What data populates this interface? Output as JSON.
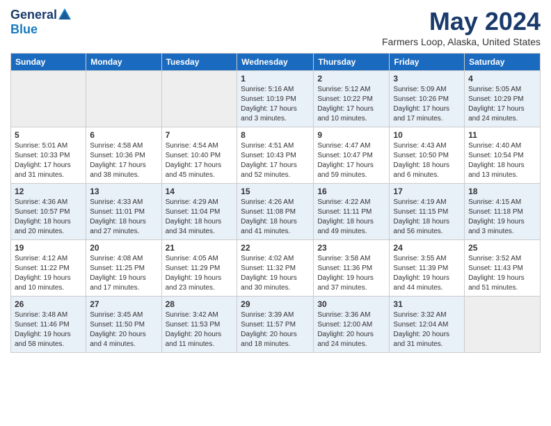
{
  "header": {
    "logo": {
      "general": "General",
      "blue": "Blue"
    },
    "title": "May 2024",
    "location": "Farmers Loop, Alaska, United States"
  },
  "weekdays": [
    "Sunday",
    "Monday",
    "Tuesday",
    "Wednesday",
    "Thursday",
    "Friday",
    "Saturday"
  ],
  "weeks": [
    [
      {
        "day": "",
        "sunrise": "",
        "sunset": "",
        "daylight": "",
        "empty": true
      },
      {
        "day": "",
        "sunrise": "",
        "sunset": "",
        "daylight": "",
        "empty": true
      },
      {
        "day": "",
        "sunrise": "",
        "sunset": "",
        "daylight": "",
        "empty": true
      },
      {
        "day": "1",
        "sunrise": "Sunrise: 5:16 AM",
        "sunset": "Sunset: 10:19 PM",
        "daylight": "Daylight: 17 hours and 3 minutes.",
        "empty": false
      },
      {
        "day": "2",
        "sunrise": "Sunrise: 5:12 AM",
        "sunset": "Sunset: 10:22 PM",
        "daylight": "Daylight: 17 hours and 10 minutes.",
        "empty": false
      },
      {
        "day": "3",
        "sunrise": "Sunrise: 5:09 AM",
        "sunset": "Sunset: 10:26 PM",
        "daylight": "Daylight: 17 hours and 17 minutes.",
        "empty": false
      },
      {
        "day": "4",
        "sunrise": "Sunrise: 5:05 AM",
        "sunset": "Sunset: 10:29 PM",
        "daylight": "Daylight: 17 hours and 24 minutes.",
        "empty": false
      }
    ],
    [
      {
        "day": "5",
        "sunrise": "Sunrise: 5:01 AM",
        "sunset": "Sunset: 10:33 PM",
        "daylight": "Daylight: 17 hours and 31 minutes.",
        "empty": false
      },
      {
        "day": "6",
        "sunrise": "Sunrise: 4:58 AM",
        "sunset": "Sunset: 10:36 PM",
        "daylight": "Daylight: 17 hours and 38 minutes.",
        "empty": false
      },
      {
        "day": "7",
        "sunrise": "Sunrise: 4:54 AM",
        "sunset": "Sunset: 10:40 PM",
        "daylight": "Daylight: 17 hours and 45 minutes.",
        "empty": false
      },
      {
        "day": "8",
        "sunrise": "Sunrise: 4:51 AM",
        "sunset": "Sunset: 10:43 PM",
        "daylight": "Daylight: 17 hours and 52 minutes.",
        "empty": false
      },
      {
        "day": "9",
        "sunrise": "Sunrise: 4:47 AM",
        "sunset": "Sunset: 10:47 PM",
        "daylight": "Daylight: 17 hours and 59 minutes.",
        "empty": false
      },
      {
        "day": "10",
        "sunrise": "Sunrise: 4:43 AM",
        "sunset": "Sunset: 10:50 PM",
        "daylight": "Daylight: 18 hours and 6 minutes.",
        "empty": false
      },
      {
        "day": "11",
        "sunrise": "Sunrise: 4:40 AM",
        "sunset": "Sunset: 10:54 PM",
        "daylight": "Daylight: 18 hours and 13 minutes.",
        "empty": false
      }
    ],
    [
      {
        "day": "12",
        "sunrise": "Sunrise: 4:36 AM",
        "sunset": "Sunset: 10:57 PM",
        "daylight": "Daylight: 18 hours and 20 minutes.",
        "empty": false
      },
      {
        "day": "13",
        "sunrise": "Sunrise: 4:33 AM",
        "sunset": "Sunset: 11:01 PM",
        "daylight": "Daylight: 18 hours and 27 minutes.",
        "empty": false
      },
      {
        "day": "14",
        "sunrise": "Sunrise: 4:29 AM",
        "sunset": "Sunset: 11:04 PM",
        "daylight": "Daylight: 18 hours and 34 minutes.",
        "empty": false
      },
      {
        "day": "15",
        "sunrise": "Sunrise: 4:26 AM",
        "sunset": "Sunset: 11:08 PM",
        "daylight": "Daylight: 18 hours and 41 minutes.",
        "empty": false
      },
      {
        "day": "16",
        "sunrise": "Sunrise: 4:22 AM",
        "sunset": "Sunset: 11:11 PM",
        "daylight": "Daylight: 18 hours and 49 minutes.",
        "empty": false
      },
      {
        "day": "17",
        "sunrise": "Sunrise: 4:19 AM",
        "sunset": "Sunset: 11:15 PM",
        "daylight": "Daylight: 18 hours and 56 minutes.",
        "empty": false
      },
      {
        "day": "18",
        "sunrise": "Sunrise: 4:15 AM",
        "sunset": "Sunset: 11:18 PM",
        "daylight": "Daylight: 19 hours and 3 minutes.",
        "empty": false
      }
    ],
    [
      {
        "day": "19",
        "sunrise": "Sunrise: 4:12 AM",
        "sunset": "Sunset: 11:22 PM",
        "daylight": "Daylight: 19 hours and 10 minutes.",
        "empty": false
      },
      {
        "day": "20",
        "sunrise": "Sunrise: 4:08 AM",
        "sunset": "Sunset: 11:25 PM",
        "daylight": "Daylight: 19 hours and 17 minutes.",
        "empty": false
      },
      {
        "day": "21",
        "sunrise": "Sunrise: 4:05 AM",
        "sunset": "Sunset: 11:29 PM",
        "daylight": "Daylight: 19 hours and 23 minutes.",
        "empty": false
      },
      {
        "day": "22",
        "sunrise": "Sunrise: 4:02 AM",
        "sunset": "Sunset: 11:32 PM",
        "daylight": "Daylight: 19 hours and 30 minutes.",
        "empty": false
      },
      {
        "day": "23",
        "sunrise": "Sunrise: 3:58 AM",
        "sunset": "Sunset: 11:36 PM",
        "daylight": "Daylight: 19 hours and 37 minutes.",
        "empty": false
      },
      {
        "day": "24",
        "sunrise": "Sunrise: 3:55 AM",
        "sunset": "Sunset: 11:39 PM",
        "daylight": "Daylight: 19 hours and 44 minutes.",
        "empty": false
      },
      {
        "day": "25",
        "sunrise": "Sunrise: 3:52 AM",
        "sunset": "Sunset: 11:43 PM",
        "daylight": "Daylight: 19 hours and 51 minutes.",
        "empty": false
      }
    ],
    [
      {
        "day": "26",
        "sunrise": "Sunrise: 3:48 AM",
        "sunset": "Sunset: 11:46 PM",
        "daylight": "Daylight: 19 hours and 58 minutes.",
        "empty": false
      },
      {
        "day": "27",
        "sunrise": "Sunrise: 3:45 AM",
        "sunset": "Sunset: 11:50 PM",
        "daylight": "Daylight: 20 hours and 4 minutes.",
        "empty": false
      },
      {
        "day": "28",
        "sunrise": "Sunrise: 3:42 AM",
        "sunset": "Sunset: 11:53 PM",
        "daylight": "Daylight: 20 hours and 11 minutes.",
        "empty": false
      },
      {
        "day": "29",
        "sunrise": "Sunrise: 3:39 AM",
        "sunset": "Sunset: 11:57 PM",
        "daylight": "Daylight: 20 hours and 18 minutes.",
        "empty": false
      },
      {
        "day": "30",
        "sunrise": "Sunrise: 3:36 AM",
        "sunset": "Sunset: 12:00 AM",
        "daylight": "Daylight: 20 hours and 24 minutes.",
        "empty": false
      },
      {
        "day": "31",
        "sunrise": "Sunrise: 3:32 AM",
        "sunset": "Sunset: 12:04 AM",
        "daylight": "Daylight: 20 hours and 31 minutes.",
        "empty": false
      },
      {
        "day": "",
        "sunrise": "",
        "sunset": "",
        "daylight": "",
        "empty": true
      }
    ]
  ]
}
